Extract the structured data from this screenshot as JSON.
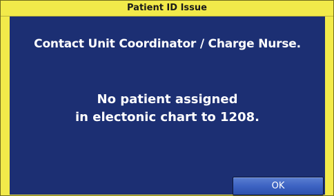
{
  "dialog": {
    "title": "Patient ID Issue",
    "headline": "Contact Unit Coordinator / Charge Nurse.",
    "message_line1": "No patient assigned",
    "message_line2": "in electonic chart to 1208.",
    "ok_label": "OK"
  },
  "colors": {
    "title_bar": "#f2ea4a",
    "panel": "#1c2f73",
    "button": "#3d63c3",
    "text": "#ffffff"
  }
}
